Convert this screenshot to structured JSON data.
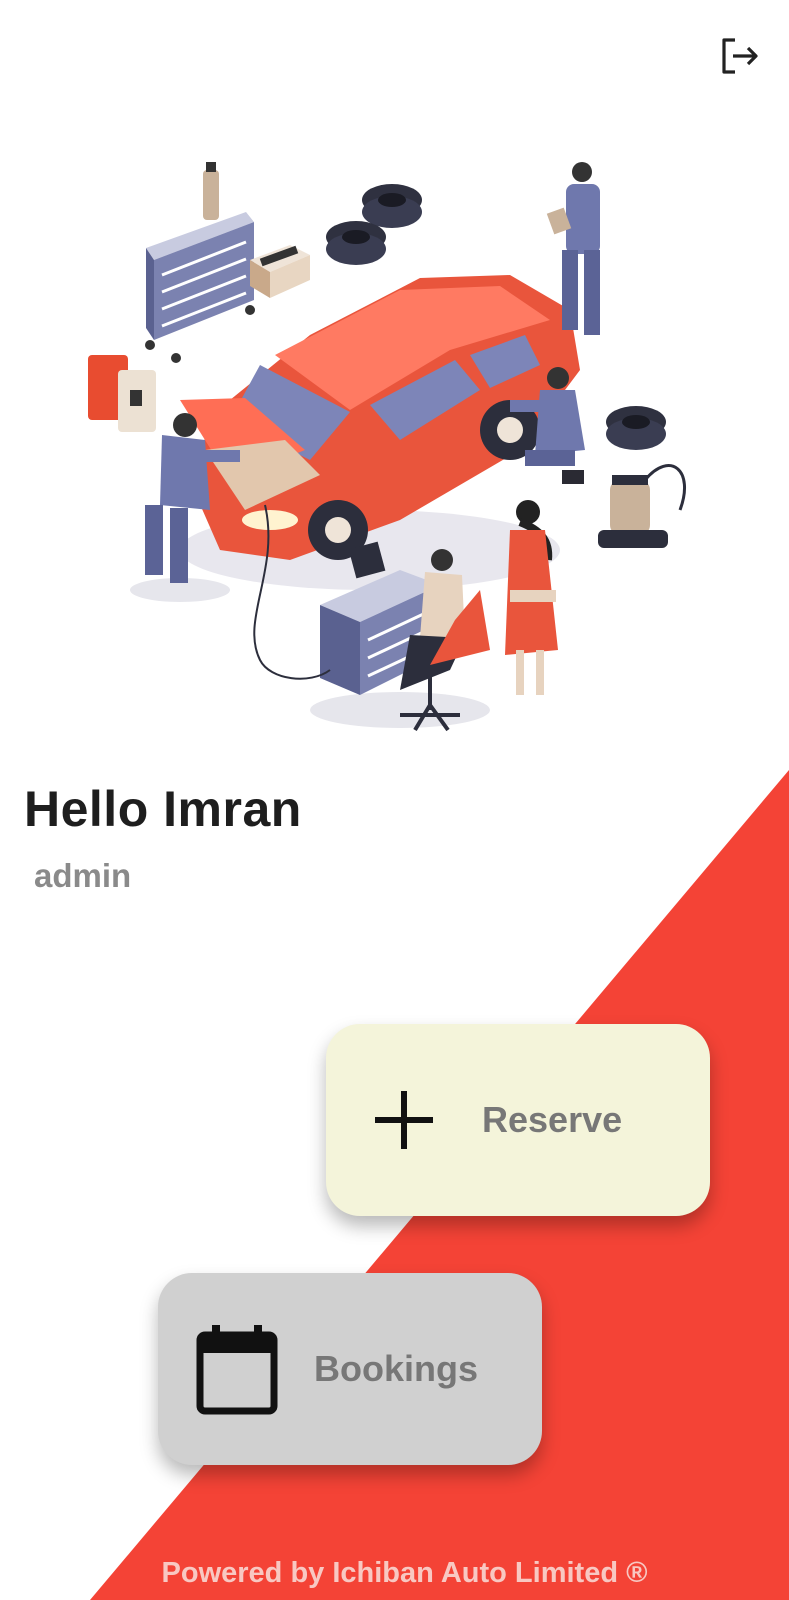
{
  "colors": {
    "accent_red": "#f44336",
    "reserve_bg": "#f4f4da",
    "bookings_bg": "#d0d0d0",
    "label_gray": "#777777"
  },
  "header": {
    "logout_icon": "logout-icon"
  },
  "hero": {
    "illustration": "car-service-workshop-illustration"
  },
  "user": {
    "greeting": "Hello Imran",
    "role": "admin"
  },
  "actions": {
    "reserve": {
      "label": "Reserve",
      "icon": "plus-icon"
    },
    "bookings": {
      "label": "Bookings",
      "icon": "calendar-icon"
    }
  },
  "footer": {
    "text": "Powered by Ichiban Auto Limited ®"
  }
}
